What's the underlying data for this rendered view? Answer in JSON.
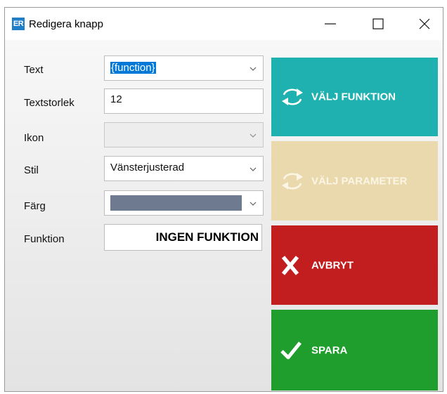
{
  "window": {
    "icon_text": "ER",
    "title": "Redigera knapp",
    "controls": {
      "minimize_icon": "minimize-icon",
      "maximize_icon": "maximize-icon",
      "close_icon": "close-icon"
    }
  },
  "form": {
    "text": {
      "label": "Text",
      "value": "{function}",
      "selected": true
    },
    "font_size": {
      "label": "Textstorlek",
      "value": "12"
    },
    "icon": {
      "label": "Ikon",
      "value": "",
      "enabled": false
    },
    "style": {
      "label": "Stil",
      "value": "Vänsterjusterad"
    },
    "color": {
      "label": "Färg",
      "swatch": "#6d7a8f"
    },
    "function": {
      "label": "Funktion",
      "value": "INGEN FUNKTION"
    }
  },
  "actions": {
    "choose_function": {
      "label": "VÄLJ FUNKTION",
      "color": "#1fb1b0",
      "icon": "swap-arrows-icon"
    },
    "choose_parameter": {
      "label": "VÄLJ PARAMETER",
      "color": "#ead9ad",
      "icon": "swap-arrows-icon",
      "enabled": false
    },
    "cancel": {
      "label": "AVBRYT",
      "color": "#c21d1f",
      "icon": "x-icon"
    },
    "save": {
      "label": "SPARA",
      "color": "#1f9e2e",
      "icon": "checkmark-icon"
    }
  }
}
